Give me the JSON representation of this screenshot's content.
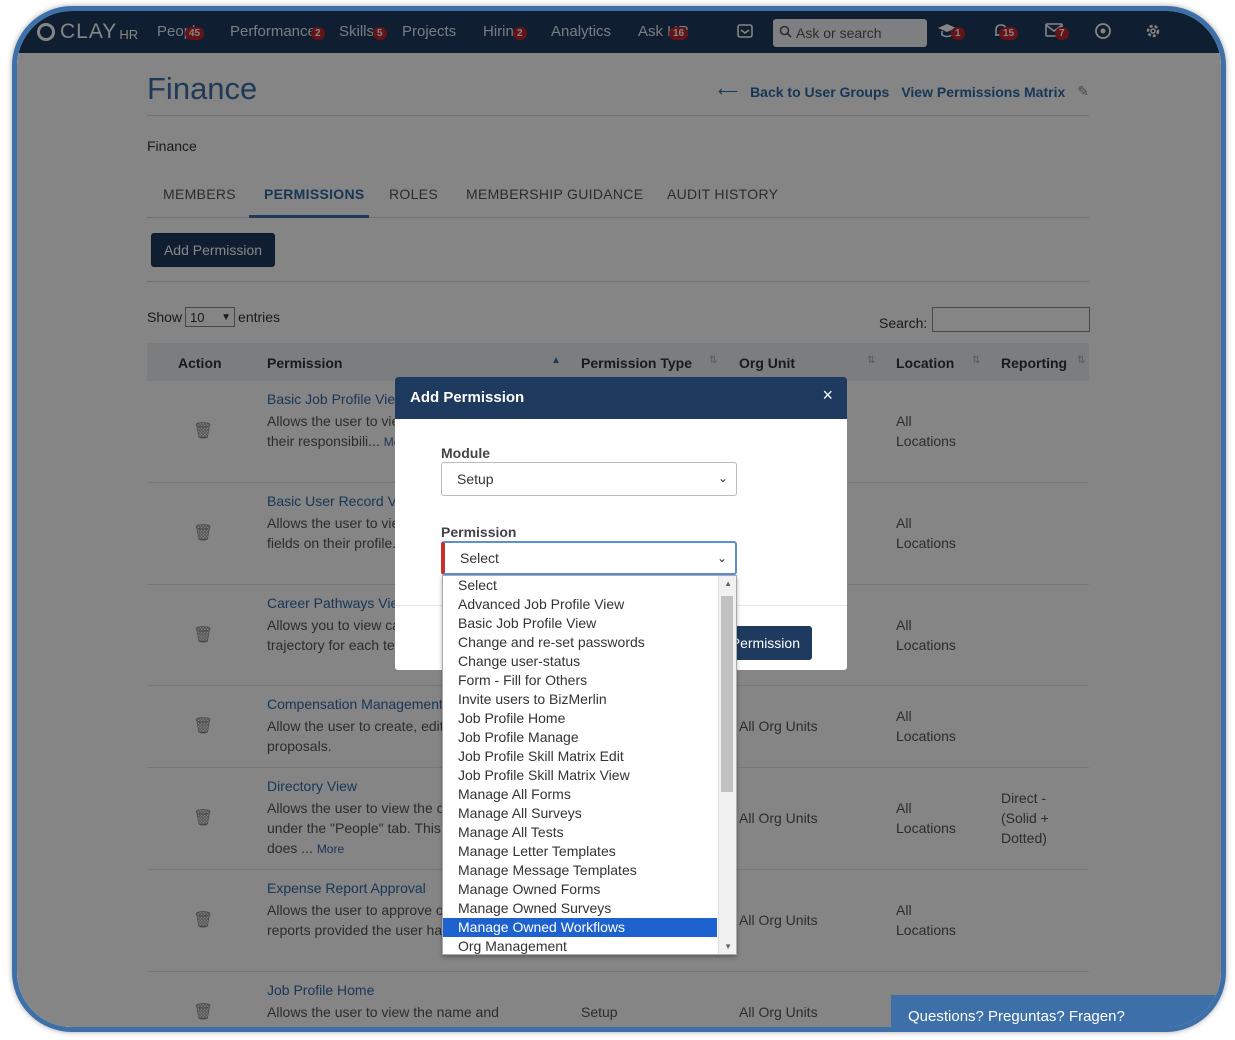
{
  "brand": {
    "name": "CLAY",
    "suffix": "HR"
  },
  "nav": {
    "items": [
      {
        "label": "People",
        "badge": "45"
      },
      {
        "label": "Performance",
        "badge": "2"
      },
      {
        "label": "Skills",
        "badge": "5"
      },
      {
        "label": "Projects",
        "badge": ""
      },
      {
        "label": "Hiring",
        "badge": "2"
      },
      {
        "label": "Analytics",
        "badge": ""
      },
      {
        "label": "Ask HR",
        "badge": "16"
      }
    ],
    "search_placeholder": "Ask or search",
    "icon_badges": {
      "learning": "1",
      "alerts": "15",
      "messages": "7"
    }
  },
  "page": {
    "title": "Finance",
    "back_link": "Back to User Groups",
    "matrix_link": "View Permissions Matrix",
    "breadcrumb": "Finance"
  },
  "tabs": [
    "MEMBERS",
    "PERMISSIONS",
    "ROLES",
    "MEMBERSHIP GUIDANCE",
    "AUDIT HISTORY"
  ],
  "add_button": "Add Permission",
  "table_controls": {
    "show": "Show",
    "entries_value": "10",
    "entries": "entries",
    "search": "Search:"
  },
  "table": {
    "headers": [
      "Action",
      "Permission",
      "Permission Type",
      "Org Unit",
      "Location",
      "Reporting"
    ],
    "rows": [
      {
        "title": "Basic Job Profile View",
        "desc": "Allows the user to view job profiles, including their responsibili...",
        "type": "",
        "org": "",
        "loc1": "All",
        "loc2": "Locations",
        "rep": ""
      },
      {
        "title": "Basic User Record View",
        "desc": "Allows the user to view users, limited to the fields on their profile...",
        "type": "",
        "org": "",
        "loc1": "All",
        "loc2": "Locations",
        "rep": ""
      },
      {
        "title": "Career Pathways View",
        "desc": "Allows you to view career description and the trajectory for each team member...",
        "type": "",
        "org": "",
        "loc1": "All",
        "loc2": "Locations",
        "rep": ""
      },
      {
        "title": "Compensation Management",
        "desc": "Allow the user to create, edit compensation proposals.",
        "type": "",
        "org": "All Org Units",
        "loc1": "All",
        "loc2": "Locations",
        "rep": ""
      },
      {
        "title": "Directory View",
        "desc": "Allows the user to view the company directory under the \"People\" tab. This permission alone does ...",
        "type": "",
        "org": "All Org Units",
        "loc1": "All",
        "loc2": "Locations",
        "rep": "Direct - (Solid + Dotted)"
      },
      {
        "title": "Expense Report Approval",
        "desc": "Allows the user to approve or reject expense reports provided the user has access the ...",
        "type": "",
        "org": "All Org Units",
        "loc1": "All",
        "loc2": "Locations",
        "rep": ""
      },
      {
        "title": "Job Profile Home",
        "desc": "Allows the user to view the name and description of all job profiles",
        "type": "Setup",
        "org": "All Org Units",
        "loc1": "",
        "loc2": "",
        "rep": ""
      }
    ],
    "more": "More"
  },
  "modal": {
    "title": "Add Permission",
    "module_label": "Module",
    "module_value": "Setup",
    "permission_label": "Permission",
    "permission_value": "Select",
    "submit": "Add Permission",
    "options": [
      "Select",
      "Advanced Job Profile View",
      "Basic Job Profile View",
      "Change and re-set passwords",
      "Change user-status",
      "Form - Fill for Others",
      "Invite users to BizMerlin",
      "Job Profile Home",
      "Job Profile Manage",
      "Job Profile Skill Matrix Edit",
      "Job Profile Skill Matrix View",
      "Manage All Forms",
      "Manage All Surveys",
      "Manage All Tests",
      "Manage Letter Templates",
      "Manage Message Templates",
      "Manage Owned Forms",
      "Manage Owned Surveys",
      "Manage Owned Workflows",
      "Org Management"
    ],
    "highlighted_option": "Manage Owned Workflows"
  },
  "chat": "Questions? Preguntas? Fragen?",
  "colors": {
    "nav": "#1f3a5f",
    "accent": "#3d6fa8",
    "link": "#2f6aa6",
    "badge": "#c0262d",
    "highlight": "#1e62d0"
  }
}
